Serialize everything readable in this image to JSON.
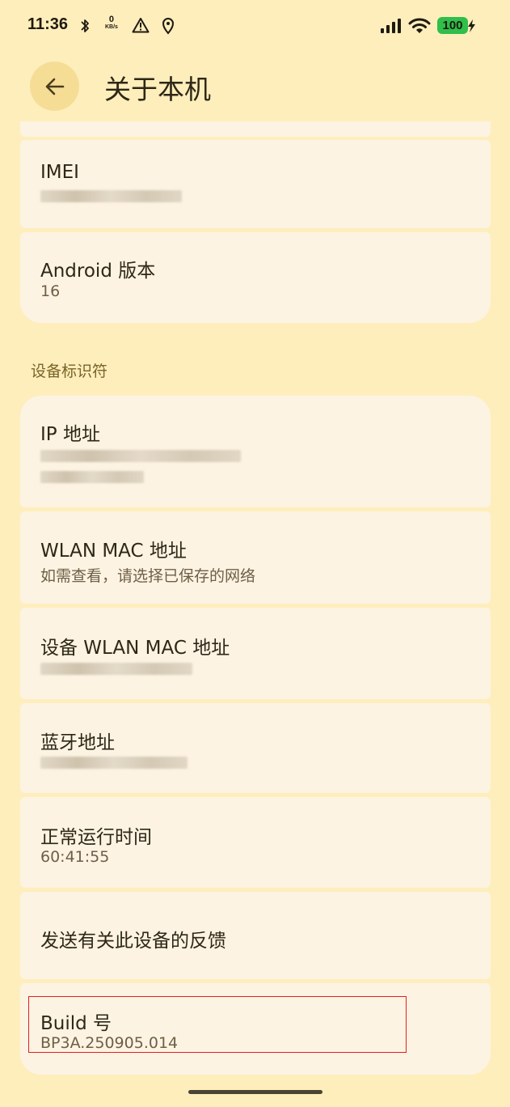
{
  "status_bar": {
    "time": "11:36",
    "net_speed_value": "0",
    "net_speed_unit": "KB/s",
    "battery": "100"
  },
  "header": {
    "title": "关于本机"
  },
  "items": {
    "imei": {
      "title": "IMEI"
    },
    "android_version": {
      "title": "Android 版本",
      "value": "16"
    },
    "section_device_ids": "设备标识符",
    "ip_address": {
      "title": "IP 地址"
    },
    "wlan_mac": {
      "title": "WLAN MAC 地址",
      "value": "如需查看，请选择已保存的网络"
    },
    "device_wlan_mac": {
      "title": "设备 WLAN MAC 地址"
    },
    "bluetooth": {
      "title": "蓝牙地址"
    },
    "uptime": {
      "title": "正常运行时间",
      "value": "60:41:55"
    },
    "feedback": {
      "title": "发送有关此设备的反馈"
    },
    "build": {
      "title": "Build 号",
      "value": "BP3A.250905.014"
    }
  },
  "colors": {
    "background": "#fdeebc",
    "card": "#fdf3e3",
    "back_button": "#f6dd95",
    "battery": "#2fbf4a",
    "highlight": "#e02020"
  },
  "icons": [
    "bluetooth-icon",
    "warning-icon",
    "location-icon",
    "signal-icon",
    "wifi-icon",
    "charging-icon",
    "back-arrow-icon"
  ]
}
